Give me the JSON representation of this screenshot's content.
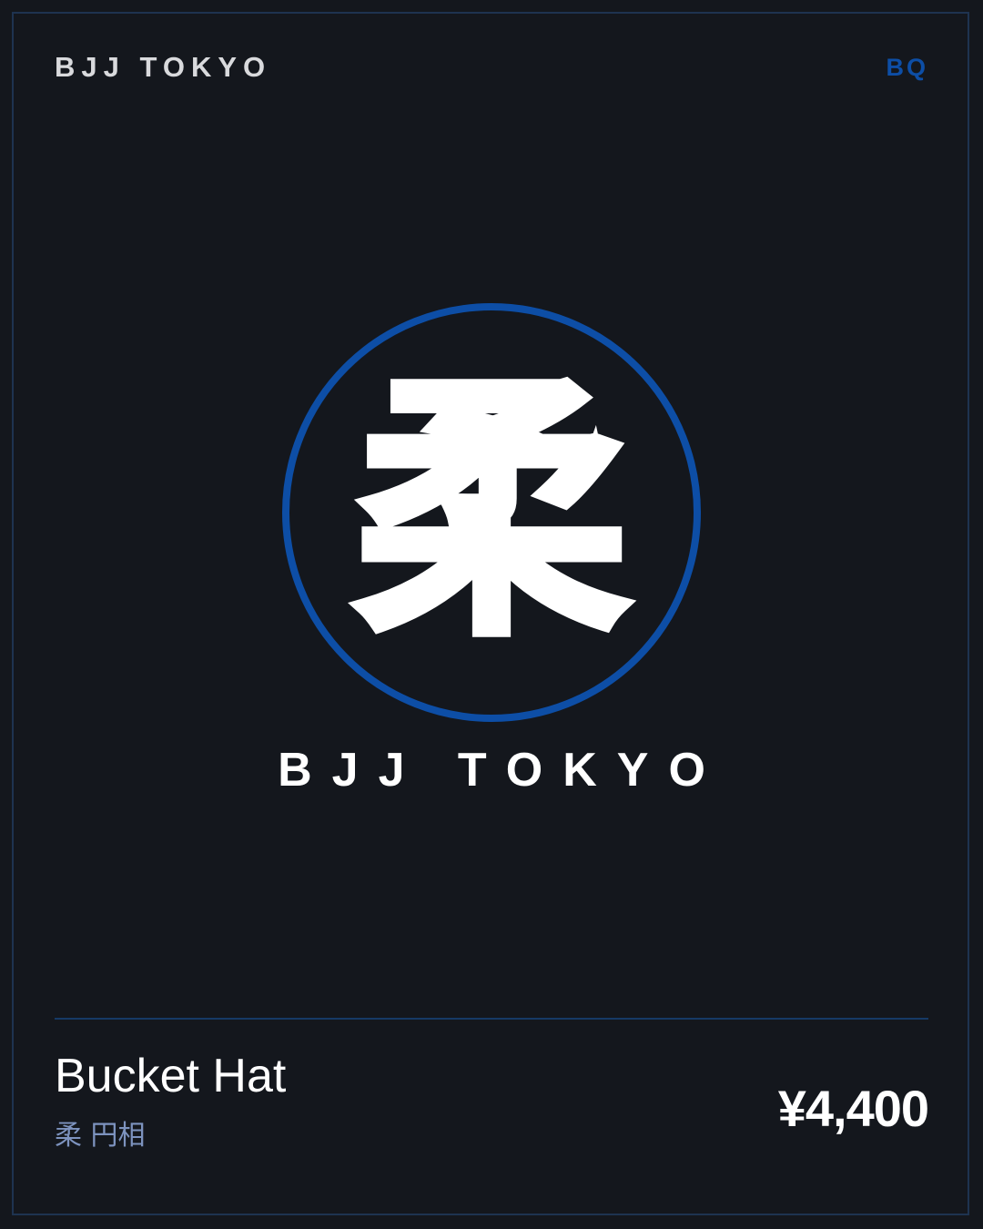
{
  "header": {
    "brand": "BJJ TOKYO",
    "code": "BQ"
  },
  "emblem": {
    "kanji": "柔",
    "wordmark": "BJJ TOKYO",
    "ring_color": "#0d4ea6"
  },
  "product": {
    "name": "Bucket Hat",
    "subtitle": "柔 円相",
    "price": "¥4,400"
  },
  "colors": {
    "background": "#14171d",
    "accent": "#0d4ea6",
    "border": "#1e3350",
    "subtitle": "#7d93bf"
  }
}
